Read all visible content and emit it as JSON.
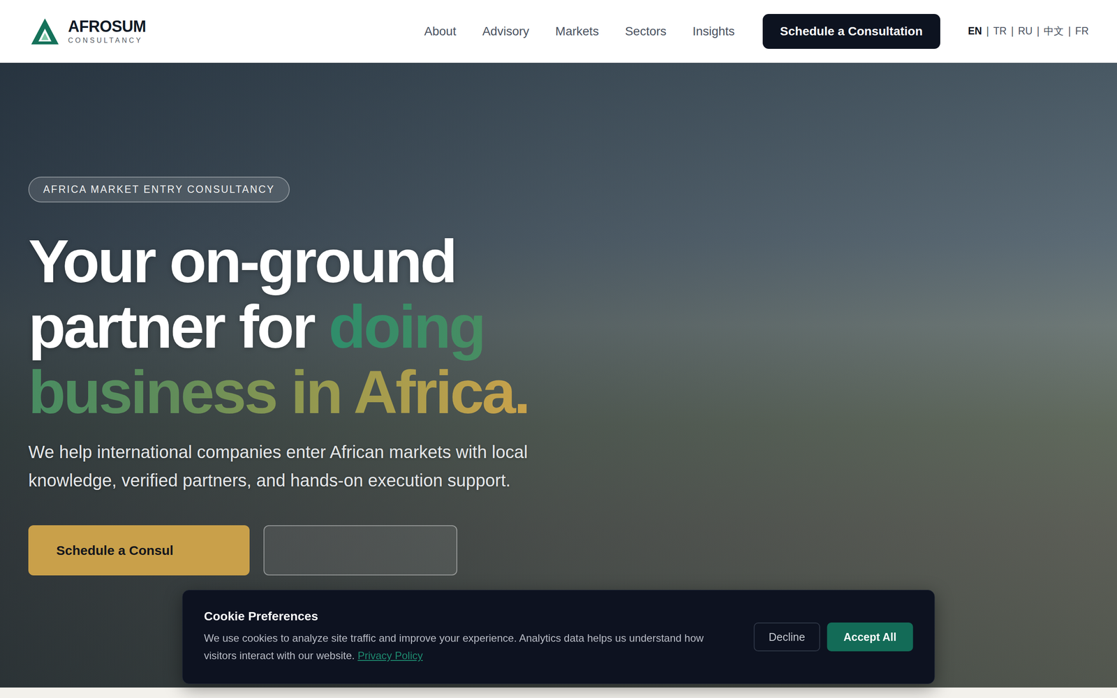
{
  "logo": {
    "name": "AFROSUM",
    "tagline": "CONSULTANCY"
  },
  "nav": {
    "items": [
      "About",
      "Advisory",
      "Markets",
      "Sectors",
      "Insights"
    ],
    "cta": "Schedule a Consultation"
  },
  "languages": {
    "separator": "|",
    "items": [
      {
        "label": "EN",
        "selected": true
      },
      {
        "label": "TR",
        "selected": false
      },
      {
        "label": "RU",
        "selected": false
      },
      {
        "label": "中文",
        "selected": false
      },
      {
        "label": "FR",
        "selected": false
      }
    ]
  },
  "hero": {
    "badge": "AFRICA MARKET ENTRY CONSULTANCY",
    "headline_lead": "Your on-ground partner for",
    "headline_accent": "doing business in Africa.",
    "subtitle": "We help international companies enter African markets with local knowledge, verified partners, and hands-on execution support.",
    "primary_button": "Schedule a Consul"
  },
  "cookie_banner": {
    "title": "Cookie Preferences",
    "text": "We use cookies to analyze site traffic and improve your experience. Analytics data helps us understand how visitors interact with our website.",
    "link": "Privacy Policy",
    "buttons": {
      "decline": "Decline",
      "accept": "Accept All"
    }
  }
}
